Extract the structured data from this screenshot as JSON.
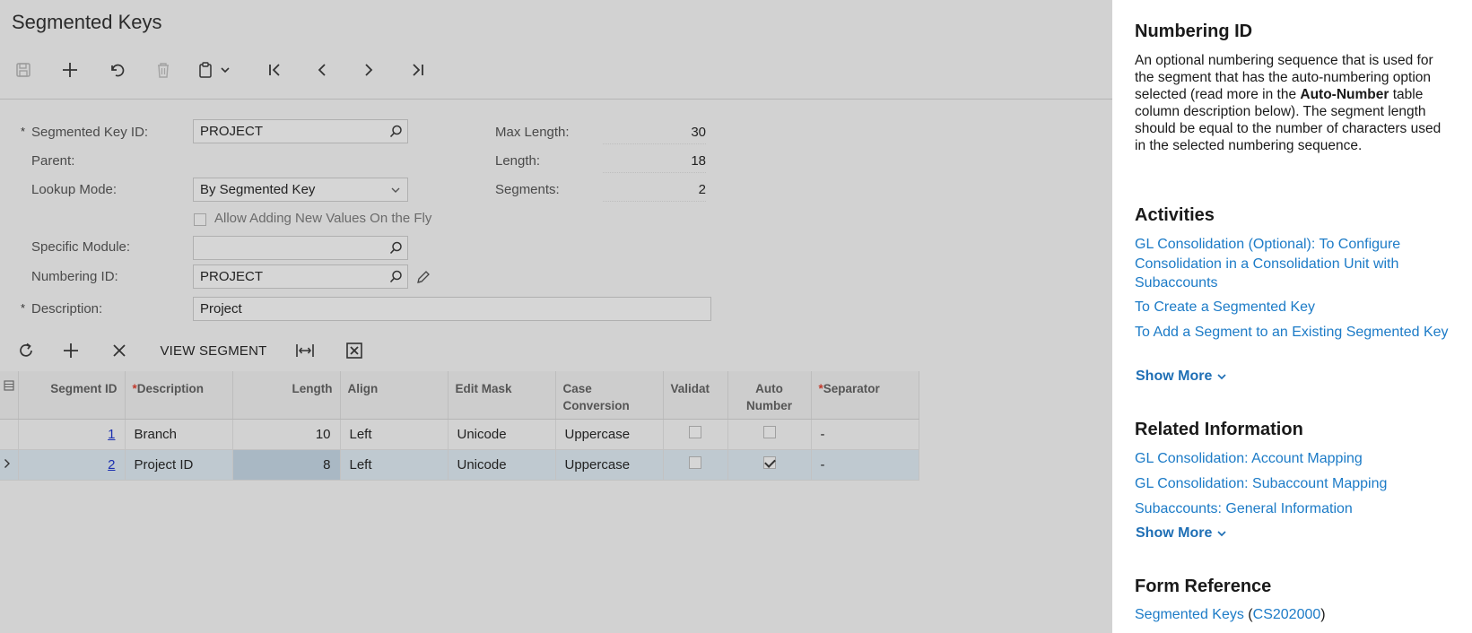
{
  "page": {
    "title": "Segmented Keys"
  },
  "toolbar": {
    "icons": [
      "save-icon",
      "add-icon",
      "undo-icon",
      "delete-icon",
      "clipboard-icon",
      "chevron-down-icon",
      "first-record-icon",
      "previous-record-icon",
      "next-record-icon",
      "last-record-icon"
    ]
  },
  "form": {
    "segmented_key_id": {
      "label": "Segmented Key ID:",
      "value": "PROJECT",
      "required": "*"
    },
    "parent": {
      "label": "Parent:"
    },
    "lookup_mode": {
      "label": "Lookup Mode:",
      "value": "By Segmented Key"
    },
    "allow_adding": {
      "label": "Allow Adding New Values On the Fly",
      "checked": false
    },
    "specific_module": {
      "label": "Specific Module:",
      "value": ""
    },
    "numbering_id": {
      "label": "Numbering ID:",
      "value": "PROJECT"
    },
    "description": {
      "label": "Description:",
      "value": "Project",
      "required": "*"
    },
    "max_length": {
      "label": "Max Length:",
      "value": "30"
    },
    "length": {
      "label": "Length:",
      "value": "18"
    },
    "segments": {
      "label": "Segments:",
      "value": "2"
    }
  },
  "grid_toolbar": {
    "view_segment_label": "VIEW SEGMENT",
    "icons": [
      "refresh-icon",
      "add-row-icon",
      "delete-row-icon",
      "fit-columns-icon",
      "export-excel-icon"
    ]
  },
  "grid": {
    "columns": {
      "segment_id": "Segment ID",
      "description": "Description",
      "length": "Length",
      "align": "Align",
      "edit_mask": "Edit Mask",
      "case_conversion_1": "Case",
      "case_conversion_2": "Conversion",
      "validate": "Validat",
      "auto_number_1": "Auto",
      "auto_number_2": "Number",
      "separator": "Separator",
      "required_star": "*"
    },
    "rows": [
      {
        "segment_id": "1",
        "description": "Branch",
        "length": "10",
        "align": "Left",
        "edit_mask": "Unicode",
        "case_conversion": "Uppercase",
        "validate": false,
        "auto_number": false,
        "separator": "-"
      },
      {
        "segment_id": "2",
        "description": "Project ID",
        "length": "8",
        "align": "Left",
        "edit_mask": "Unicode",
        "case_conversion": "Uppercase",
        "validate": false,
        "auto_number": true,
        "separator": "-"
      }
    ]
  },
  "help": {
    "numbering_title": "Numbering ID",
    "numbering_text_1": "An optional numbering sequence that is used for the segment that has the auto-numbering option selected (read more in the ",
    "numbering_text_bold": "Auto-Number",
    "numbering_text_2": " table column description below). The segment length should be equal to the number of characters used in the selected numbering sequence.",
    "activities_title": "Activities",
    "activities": [
      "GL Consolidation (Optional): To Configure Consolidation in a Consolidation Unit with Subaccounts",
      "To Create a Segmented Key",
      "To Add a Segment to an Existing Segmented Key"
    ],
    "show_more": "Show More",
    "related_title": "Related Information",
    "related": [
      "GL Consolidation: Account Mapping",
      "GL Consolidation: Subaccount Mapping",
      "Subaccounts: General Information"
    ],
    "form_ref_title": "Form Reference",
    "form_ref_name": "Segmented Keys",
    "form_ref_open": " (",
    "form_ref_code": "CS202000",
    "form_ref_close": ")"
  },
  "colors": {
    "link": "#1c7bc7",
    "dim_bg": "#d2d2d2",
    "selected_row": "#bfc9d0"
  }
}
